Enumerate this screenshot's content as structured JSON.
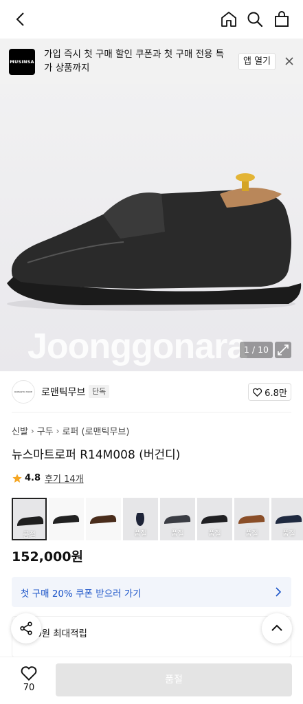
{
  "header": {
    "back_icon": "chevron-left-icon",
    "home_icon": "home-icon",
    "search_icon": "search-icon",
    "cart_icon": "shopping-bag-icon"
  },
  "promo": {
    "logo_text": "MUSINSA",
    "message": "가입 즉시 첫 구매 할인 쿠폰과 첫 구매 전용 특가 상품까지",
    "open_app_label": "앱 열기",
    "close_icon": "close-icon"
  },
  "gallery": {
    "watermark": "Joonggonara",
    "counter": "1 / 10",
    "expand_icon": "expand-icon"
  },
  "brand": {
    "name": "로맨틱무브",
    "badge": "단독",
    "logo_text": "ROMANTIC MOVE",
    "like_count": "6.8만",
    "like_icon": "heart-icon"
  },
  "breadcrumb": [
    "신발",
    "구두",
    "로퍼 (로맨틱무브)"
  ],
  "product": {
    "title": "뉴스마트로퍼 R14M008 (버건디)",
    "rating": "4.8",
    "reviews": "후기 14개",
    "price": "152,000원"
  },
  "thumbnails": [
    {
      "label": "품절",
      "selected": true
    },
    {
      "label": "",
      "selected": false
    },
    {
      "label": "",
      "selected": false
    },
    {
      "label": "품절",
      "selected": false
    },
    {
      "label": "품절",
      "selected": false
    },
    {
      "label": "품절",
      "selected": false
    },
    {
      "label": "품절",
      "selected": false
    },
    {
      "label": "품절",
      "selected": false
    }
  ],
  "coupon": {
    "text": "첫 구매 20% 쿠폰 받으러 가기"
  },
  "points": {
    "text": "0원 최대적립"
  },
  "bottom": {
    "likes": "70",
    "buy_label": "품절"
  },
  "colors": {
    "coupon_text": "#1a53c8",
    "coupon_bg": "#f2f5fb",
    "disabled_button": "#e4e4e4"
  }
}
